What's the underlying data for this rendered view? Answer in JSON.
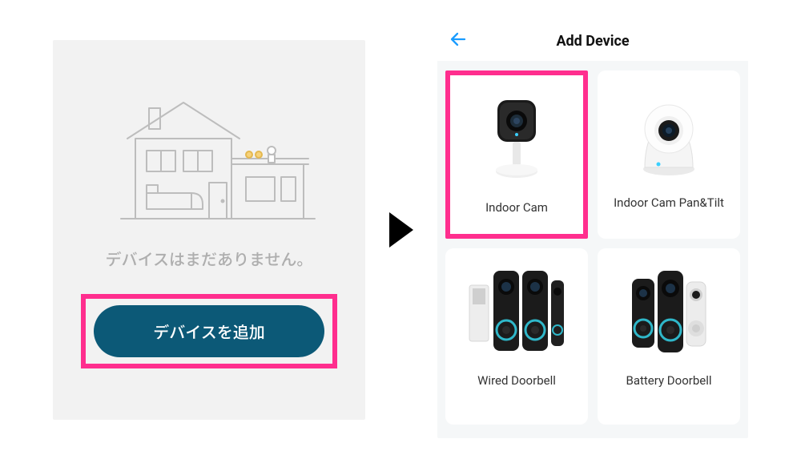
{
  "left": {
    "no_device": "デバイスはまだありません。",
    "add_button": "デバイスを追加"
  },
  "right": {
    "title": "Add Device",
    "devices": {
      "d0": "Indoor Cam",
      "d1": "Indoor Cam Pan&Tilt",
      "d2": "Wired Doorbell",
      "d3": "Battery Doorbell"
    }
  }
}
